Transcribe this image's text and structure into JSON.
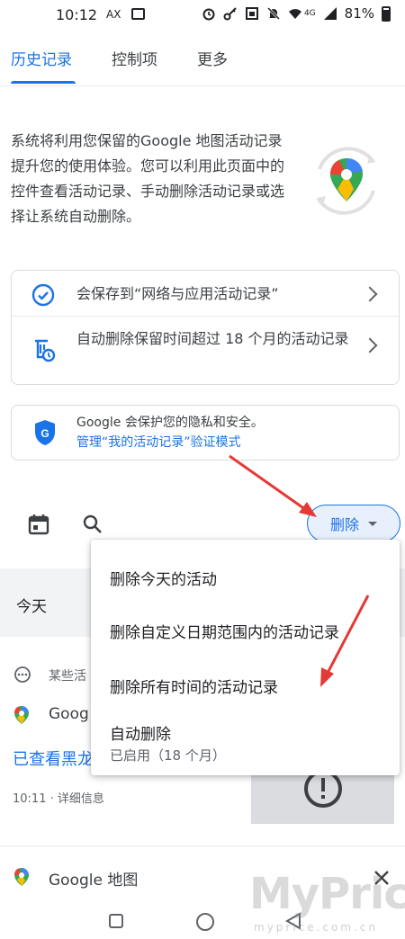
{
  "status_bar": {
    "time": "10:12",
    "carrier": "AX",
    "network": "4G",
    "battery": "81%"
  },
  "tabs": [
    {
      "label": "历史记录",
      "active": true
    },
    {
      "label": "控制项",
      "active": false
    },
    {
      "label": "更多",
      "active": false
    }
  ],
  "intro": {
    "text": "系统将利用您保留的Google 地图活动记录提升您的使用体验。您可以利用此页面中的控件查看活动记录、手动删除活动记录或选择让系统自动删除。"
  },
  "settings": [
    {
      "label": "会保存到“网络与应用活动记录”",
      "icon": "check-circle-icon"
    },
    {
      "label": "自动删除保留时间超过 18 个月的活动记录",
      "icon": "auto-delete-icon"
    }
  ],
  "privacy": {
    "text": "Google 会保护您的隐私和安全。",
    "link": "管理“我的活动记录”验证模式"
  },
  "toolbar": {
    "delete_label": "删除"
  },
  "list": {
    "section": "今天",
    "item1_prefix": "某些活",
    "item1_title": "Goog",
    "item1_link": "已查看黑龙",
    "item1_meta": "10:11 · 详细信息",
    "item2_title": "Google 地图"
  },
  "menu": {
    "items": [
      "删除今天的活动",
      "删除自定义日期范围内的活动记录",
      "删除所有时间的活动记录",
      "自动删除"
    ],
    "auto_delete_status": "已启用（18 个月）"
  },
  "watermark": {
    "text": "MyPrice",
    "sub": "myprice.com.cn"
  },
  "colors": {
    "accent": "#1a73e8",
    "annotation": "#e53935"
  }
}
